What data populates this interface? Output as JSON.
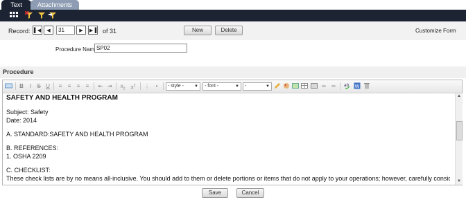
{
  "tabs": [
    {
      "label": "Text",
      "active": true
    },
    {
      "label": "Attachments",
      "active": false
    }
  ],
  "toolbar_icons": [
    "grid-icon",
    "filter-clear-icon",
    "filter-icon",
    "filter-apply-icon"
  ],
  "record_nav": {
    "label": "Record:",
    "current": "31",
    "total_text": "of 31",
    "new_label": "New",
    "delete_label": "Delete",
    "customize_label": "Customize Form"
  },
  "procedure_name": {
    "label": "Procedure Name",
    "value": "SP02"
  },
  "procedure_section": {
    "title": "Procedure"
  },
  "editor": {
    "style_select": "- style -",
    "font_select": "- font -",
    "size_select": "-",
    "heading": "SAFETY AND HEALTH PROGRAM",
    "lines": [
      "Subject: Safety",
      "Date: 2014",
      "A. STANDARD:SAFETY AND HEALTH PROGRAM",
      "B. REFERENCES:",
      "1. OSHA 2209",
      "C. CHECKLIST:",
      "These check lists are by no means all-inclusive. You should add to them or delete portions or items that do not apply to your operations; however, carefully consider"
    ]
  },
  "footer": {
    "save_label": "Save",
    "cancel_label": "Cancel"
  },
  "colors": {
    "dark_bar": "#1c2333",
    "inactive_tab": "#8e9db3"
  }
}
